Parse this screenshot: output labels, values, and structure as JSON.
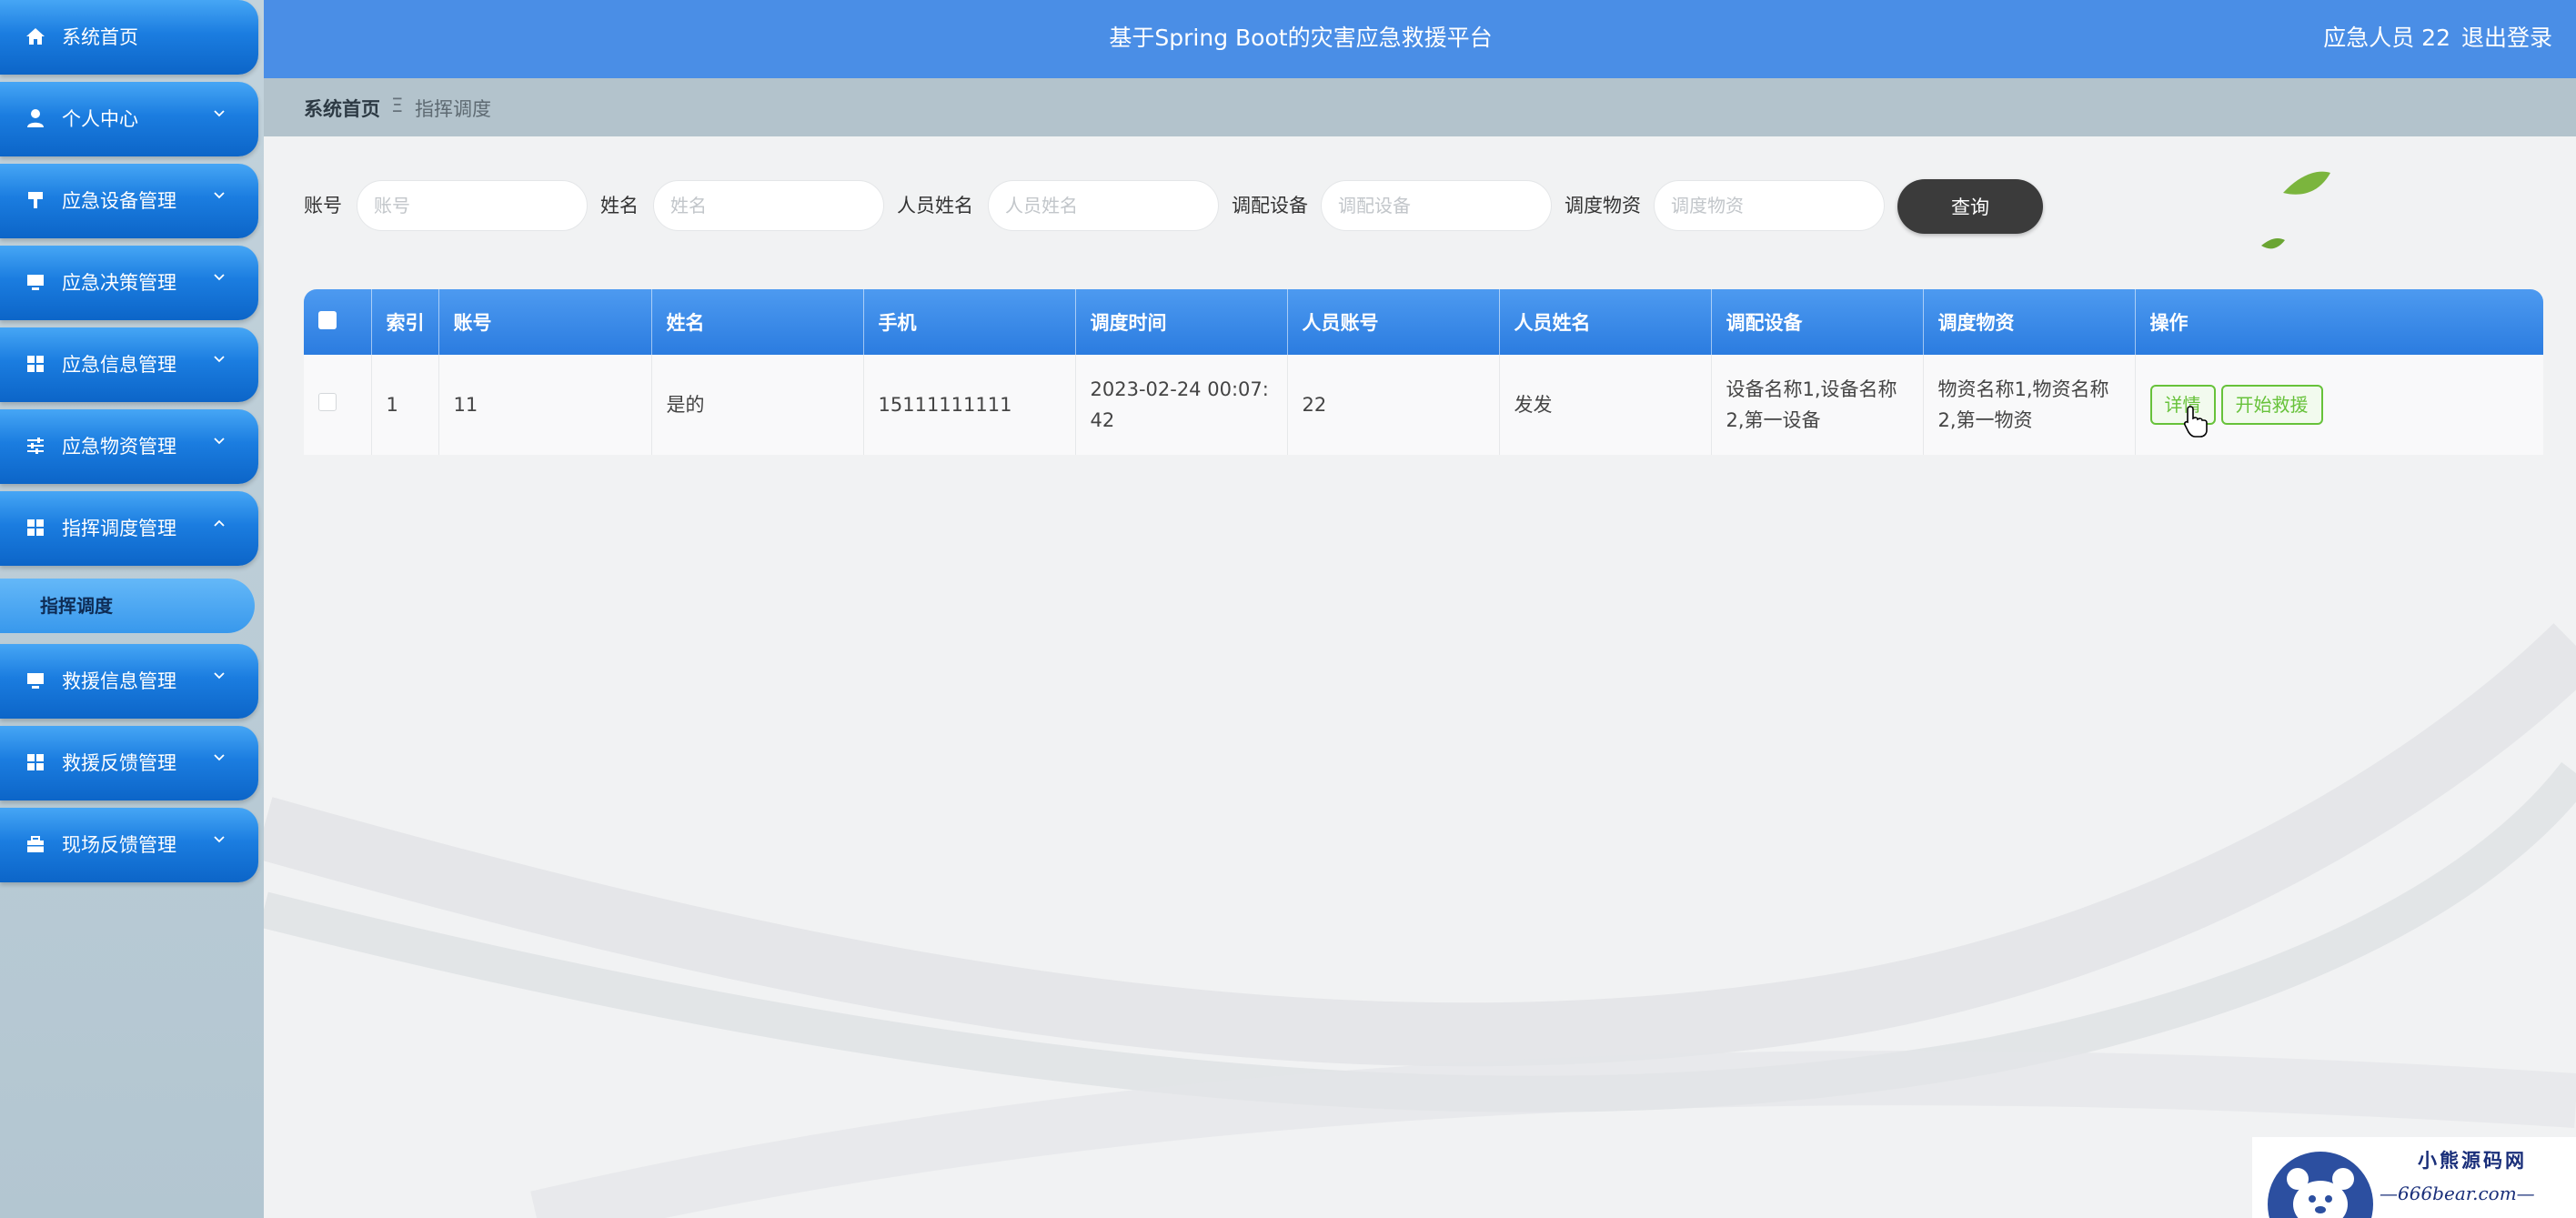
{
  "header": {
    "title": "基于Spring Boot的灾害应急救援平台",
    "user": "应急人员 22",
    "logout": "退出登录"
  },
  "sidebar": {
    "items": [
      {
        "label": "系统首页",
        "icon": "home-icon"
      },
      {
        "label": "个人中心",
        "icon": "user-icon"
      },
      {
        "label": "应急设备管理",
        "icon": "tool-icon"
      },
      {
        "label": "应急决策管理",
        "icon": "monitor-icon"
      },
      {
        "label": "应急信息管理",
        "icon": "grid-icon"
      },
      {
        "label": "应急物资管理",
        "icon": "sliders-icon"
      },
      {
        "label": "指挥调度管理",
        "icon": "grid-icon"
      },
      {
        "label": "救援信息管理",
        "icon": "monitor-icon"
      },
      {
        "label": "救援反馈管理",
        "icon": "grid-icon"
      },
      {
        "label": "现场反馈管理",
        "icon": "briefcase-icon"
      }
    ],
    "active_sub": "指挥调度"
  },
  "breadcrumb": {
    "home": "系统首页",
    "separator": "Ξ",
    "current": "指挥调度"
  },
  "search": {
    "fields": [
      {
        "label": "账号",
        "placeholder": "账号"
      },
      {
        "label": "姓名",
        "placeholder": "姓名"
      },
      {
        "label": "人员姓名",
        "placeholder": "人员姓名"
      },
      {
        "label": "调配设备",
        "placeholder": "调配设备"
      },
      {
        "label": "调度物资",
        "placeholder": "调度物资"
      }
    ],
    "button": "查询"
  },
  "table": {
    "headers": [
      "索引",
      "账号",
      "姓名",
      "手机",
      "调度时间",
      "人员账号",
      "人员姓名",
      "调配设备",
      "调度物资",
      "操作"
    ],
    "rows": [
      {
        "index": "1",
        "account": "11",
        "name": "是的",
        "phone": "15111111111",
        "time": "2023-02-24 00:07:42",
        "staff_account": "22",
        "staff_name": "发发",
        "equipment": "设备名称1,设备名称2,第一设备",
        "supplies": "物资名称1,物资名称2,第一物资",
        "actions": [
          "详情",
          "开始救援"
        ]
      }
    ]
  },
  "watermark": {
    "name": "小熊源码网",
    "url": "—666bear.com—"
  },
  "colors": {
    "accent": "#2b7ce0",
    "sidebar_item": "#1b7de0",
    "header": "#4a8ee6",
    "action_green": "#67c23a",
    "query_button": "#3b3b3b"
  }
}
